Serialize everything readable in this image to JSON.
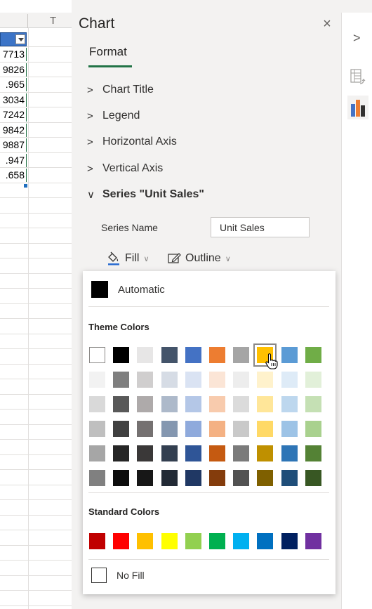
{
  "sheet": {
    "column_header": "T",
    "values": [
      "7713",
      "9826",
      ".965",
      "3034",
      "7242",
      "9842",
      "9887",
      ".947",
      ".658"
    ]
  },
  "pane": {
    "title": "Chart",
    "close_glyph": "×",
    "tab": "Format",
    "sections": [
      {
        "label": "Chart Title",
        "chevron": ">"
      },
      {
        "label": "Legend",
        "chevron": ">"
      },
      {
        "label": "Horizontal Axis",
        "chevron": ">"
      },
      {
        "label": "Vertical Axis",
        "chevron": ">"
      },
      {
        "label": "Series \"Unit Sales\"",
        "chevron": "∨"
      }
    ],
    "series_name_label": "Series Name",
    "series_name_value": "Unit Sales",
    "fill_label": "Fill",
    "outline_label": "Outline"
  },
  "color_picker": {
    "automatic_label": "Automatic",
    "theme_colors_title": "Theme Colors",
    "standard_colors_title": "Standard Colors",
    "no_fill_label": "No Fill",
    "theme_colors": [
      [
        "#ffffff",
        "#000000",
        "#e7e6e6",
        "#44546a",
        "#4472c4",
        "#ed7d31",
        "#a5a5a5",
        "#ffc000",
        "#5b9bd5",
        "#70ad47"
      ],
      [
        "#f2f2f2",
        "#7f7f7f",
        "#d0cece",
        "#d6dce5",
        "#dae3f3",
        "#fbe5d6",
        "#ededed",
        "#fff2cc",
        "#deebf7",
        "#e2f0d9"
      ],
      [
        "#d9d9d9",
        "#595959",
        "#aeaaaa",
        "#adb9ca",
        "#b4c7e7",
        "#f8cbad",
        "#dbdbdb",
        "#ffe699",
        "#bdd7ee",
        "#c5e0b4"
      ],
      [
        "#bfbfbf",
        "#404040",
        "#757171",
        "#8497b0",
        "#8faadc",
        "#f4b183",
        "#c9c9c9",
        "#ffd966",
        "#9dc3e6",
        "#a9d18e"
      ],
      [
        "#a6a6a6",
        "#262626",
        "#3a3838",
        "#333f50",
        "#2f5597",
        "#c55a11",
        "#7b7b7b",
        "#bf9000",
        "#2e75b6",
        "#548235"
      ],
      [
        "#808080",
        "#0d0d0d",
        "#171717",
        "#222a35",
        "#203864",
        "#843c0c",
        "#525252",
        "#7f6000",
        "#1f4e79",
        "#385723"
      ]
    ],
    "standard_colors": [
      "#c00000",
      "#ff0000",
      "#ffc000",
      "#ffff00",
      "#92d050",
      "#00b050",
      "#00b0f0",
      "#0070c0",
      "#002060",
      "#7030a0"
    ],
    "hovered_swatch": "#ffc000"
  },
  "icons": {
    "fill": "paint-bucket-icon",
    "outline": "pencil-outline-icon",
    "rail_collapse": "chevron-right-icon",
    "rail_pivot": "pivot-table-icon",
    "rail_chart": "bar-chart-icon"
  }
}
